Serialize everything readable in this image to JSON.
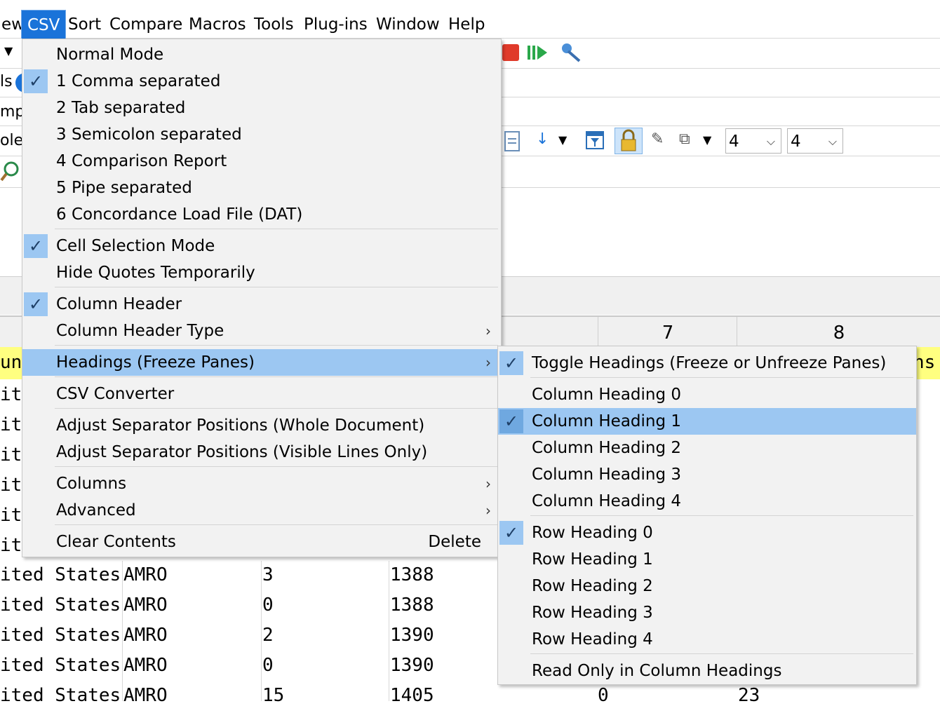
{
  "menubar": {
    "items": [
      {
        "label": "ew"
      },
      {
        "label": "CSV",
        "active": true
      },
      {
        "label": "Sort"
      },
      {
        "label": "Compare"
      },
      {
        "label": "Macros"
      },
      {
        "label": "Tools"
      },
      {
        "label": "Plug-ins"
      },
      {
        "label": "Window"
      },
      {
        "label": "Help"
      }
    ]
  },
  "background": {
    "left_fragments": [
      "ls",
      "mp",
      "ole"
    ],
    "combo1": "4",
    "combo2": "4",
    "col_headers": [
      "7",
      "8"
    ],
    "row_fragments": [
      "un",
      "it",
      "it",
      "it",
      "it",
      "it",
      "it"
    ],
    "right_fragment": "ns",
    "rows": [
      {
        "c1": "ited States",
        "c2": "AMRO",
        "c3": "3",
        "c4": "1388",
        "c5": "",
        "c6": ""
      },
      {
        "c1": "ited States",
        "c2": "AMRO",
        "c3": "0",
        "c4": "1388",
        "c5": "",
        "c6": ""
      },
      {
        "c1": "ited States",
        "c2": "AMRO",
        "c3": "2",
        "c4": "1390",
        "c5": "",
        "c6": ""
      },
      {
        "c1": "ited States",
        "c2": "AMRO",
        "c3": "0",
        "c4": "1390",
        "c5": "",
        "c6": ""
      },
      {
        "c1": "ited States",
        "c2": "AMRO",
        "c3": "15",
        "c4": "1405",
        "c5": "0",
        "c6": "23"
      }
    ]
  },
  "csv_menu": {
    "items": [
      {
        "label": "Normal Mode",
        "checked": false
      },
      {
        "label": "1 Comma separated",
        "checked": true
      },
      {
        "label": "2 Tab separated",
        "checked": false
      },
      {
        "label": "3 Semicolon separated",
        "checked": false
      },
      {
        "label": "4 Comparison Report",
        "checked": false
      },
      {
        "label": "5 Pipe separated",
        "checked": false
      },
      {
        "label": "6 Concordance Load File (DAT)",
        "checked": false
      },
      {
        "label": "Cell Selection Mode",
        "checked": true
      },
      {
        "label": "Hide Quotes Temporarily",
        "checked": false
      },
      {
        "label": "Column Header",
        "checked": true
      },
      {
        "label": "Column Header Type",
        "checked": false,
        "submenu": true
      },
      {
        "label": "Headings (Freeze Panes)",
        "checked": false,
        "submenu": true,
        "highlighted": true
      },
      {
        "label": "CSV Converter",
        "checked": false
      },
      {
        "label": "Adjust Separator Positions (Whole Document)",
        "checked": false
      },
      {
        "label": "Adjust Separator Positions (Visible Lines Only)",
        "checked": false
      },
      {
        "label": "Columns",
        "checked": false,
        "submenu": true
      },
      {
        "label": "Advanced",
        "checked": false,
        "submenu": true
      },
      {
        "label": "Clear Contents",
        "checked": false,
        "shortcut": "Delete"
      }
    ]
  },
  "headings_submenu": {
    "items": [
      {
        "label": "Toggle Headings (Freeze or Unfreeze Panes)",
        "checked": true
      },
      {
        "label": "Column Heading 0",
        "checked": false
      },
      {
        "label": "Column Heading 1",
        "checked": true,
        "highlighted": true
      },
      {
        "label": "Column Heading 2",
        "checked": false
      },
      {
        "label": "Column Heading 3",
        "checked": false
      },
      {
        "label": "Column Heading 4",
        "checked": false
      },
      {
        "label": "Row Heading 0",
        "checked": true
      },
      {
        "label": "Row Heading 1",
        "checked": false
      },
      {
        "label": "Row Heading 2",
        "checked": false
      },
      {
        "label": "Row Heading 3",
        "checked": false
      },
      {
        "label": "Row Heading 4",
        "checked": false
      },
      {
        "label": "Read Only in Column Headings",
        "checked": false
      }
    ]
  },
  "colors": {
    "accent": "#1a73d9",
    "menu_highlight": "#9cc7f2",
    "yellow": "#ffff80"
  },
  "icons": [
    "stop-icon",
    "run-macro-icon",
    "pin-icon",
    "page-icon",
    "sort-down-icon",
    "filter-icon",
    "lock-icon",
    "format-icon",
    "options-icon",
    "find-icon"
  ]
}
